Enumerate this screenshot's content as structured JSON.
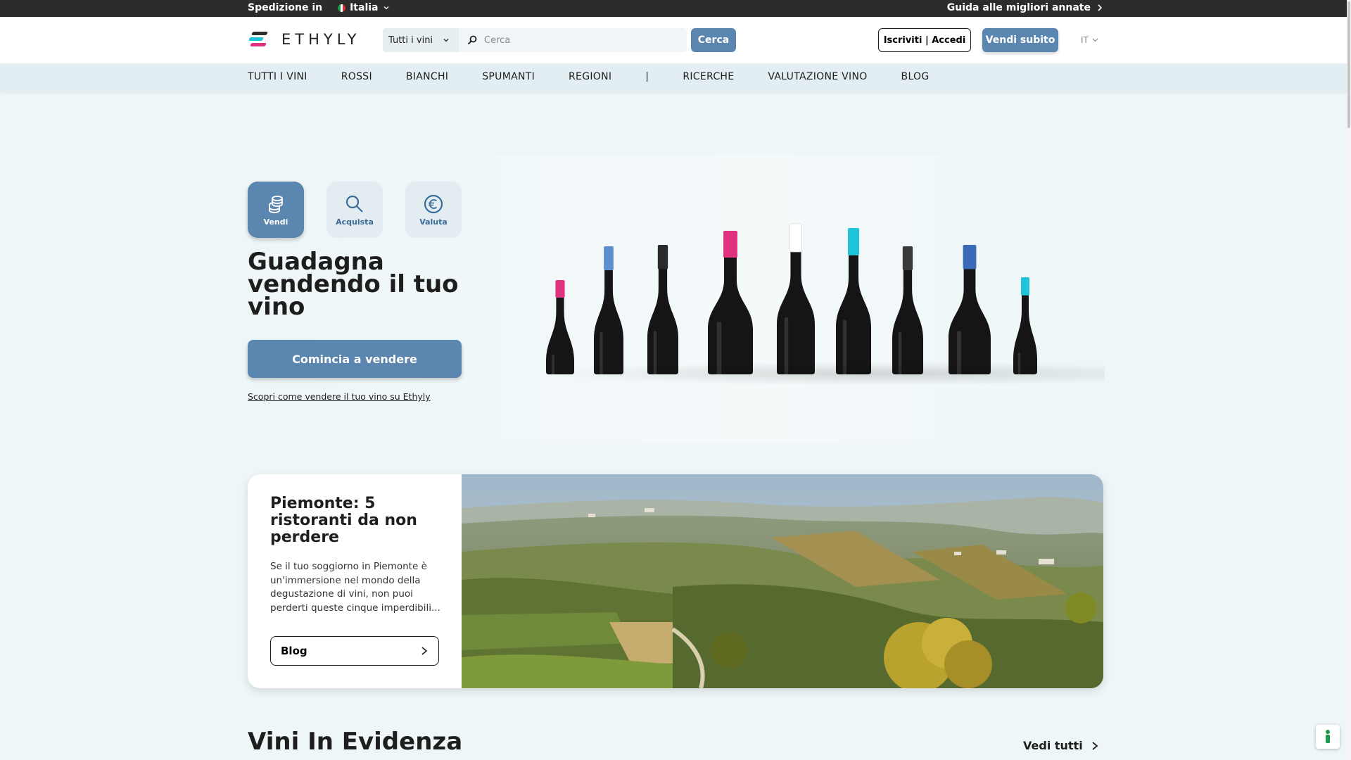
{
  "topbar": {
    "shipping_label": "Spedizione in",
    "country": "Italia",
    "guide_link": "Guida alle migliori annate"
  },
  "header": {
    "logo_text": "ETHYLY",
    "search": {
      "category": "Tutti i vini",
      "placeholder": "Cerca",
      "button": "Cerca"
    },
    "auth_button": "Iscriviti | Accedi",
    "sell_button": "Vendi subito",
    "language": "IT"
  },
  "nav": {
    "items": [
      "TUTTI I VINI",
      "ROSSI",
      "BIANCHI",
      "SPUMANTI",
      "REGIONI",
      "|",
      "RICERCHE",
      "VALUTAZIONE VINO",
      "BLOG"
    ]
  },
  "hero": {
    "tiles": [
      {
        "label": "Vendi",
        "icon": "coins-icon",
        "active": true
      },
      {
        "label": "Acquista",
        "icon": "magnifier-icon",
        "active": false
      },
      {
        "label": "Valuta",
        "icon": "euro-icon",
        "active": false
      }
    ],
    "title": "Guadagna vendendo il tuo vino",
    "cta": "Comincia a vendere",
    "link": "Scopri come vendere il tuo vino su Ethyly",
    "bottle_cap_colors": [
      "#e0327e",
      "#5b8fd0",
      "#2a2a2a",
      "#e0327e",
      "#ffffff",
      "#1fc4d8",
      "#3a3a3a",
      "#3a6ab8",
      "#1fc4d8"
    ]
  },
  "blog_card": {
    "title": "Piemonte: 5 ristoranti da non perdere",
    "text": "Se il tuo soggiorno in Piemonte è un'immersione nel mondo della degustazione di vini, non puoi perderti queste cinque imperdibili...",
    "button": "Blog"
  },
  "featured": {
    "title": "Vini In Evidenza",
    "see_all": "Vedi tutti"
  },
  "colors": {
    "accent": "#5b86b0",
    "topbar": "#2c2c2c",
    "page_bg": "#eef6f8"
  }
}
